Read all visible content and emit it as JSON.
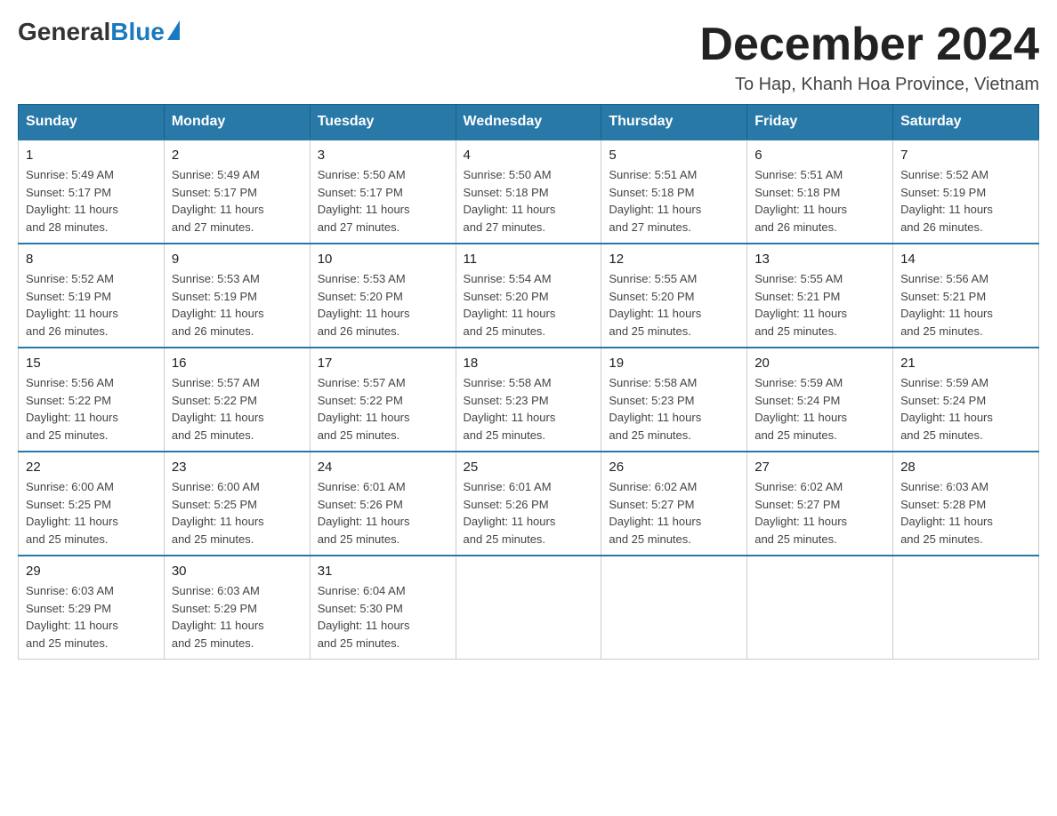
{
  "logo": {
    "general": "General",
    "blue": "Blue"
  },
  "header": {
    "month_title": "December 2024",
    "location": "To Hap, Khanh Hoa Province, Vietnam"
  },
  "days_of_week": [
    "Sunday",
    "Monday",
    "Tuesday",
    "Wednesday",
    "Thursday",
    "Friday",
    "Saturday"
  ],
  "weeks": [
    [
      {
        "day": "1",
        "sunrise": "5:49 AM",
        "sunset": "5:17 PM",
        "daylight": "11 hours and 28 minutes."
      },
      {
        "day": "2",
        "sunrise": "5:49 AM",
        "sunset": "5:17 PM",
        "daylight": "11 hours and 27 minutes."
      },
      {
        "day": "3",
        "sunrise": "5:50 AM",
        "sunset": "5:17 PM",
        "daylight": "11 hours and 27 minutes."
      },
      {
        "day": "4",
        "sunrise": "5:50 AM",
        "sunset": "5:18 PM",
        "daylight": "11 hours and 27 minutes."
      },
      {
        "day": "5",
        "sunrise": "5:51 AM",
        "sunset": "5:18 PM",
        "daylight": "11 hours and 27 minutes."
      },
      {
        "day": "6",
        "sunrise": "5:51 AM",
        "sunset": "5:18 PM",
        "daylight": "11 hours and 26 minutes."
      },
      {
        "day": "7",
        "sunrise": "5:52 AM",
        "sunset": "5:19 PM",
        "daylight": "11 hours and 26 minutes."
      }
    ],
    [
      {
        "day": "8",
        "sunrise": "5:52 AM",
        "sunset": "5:19 PM",
        "daylight": "11 hours and 26 minutes."
      },
      {
        "day": "9",
        "sunrise": "5:53 AM",
        "sunset": "5:19 PM",
        "daylight": "11 hours and 26 minutes."
      },
      {
        "day": "10",
        "sunrise": "5:53 AM",
        "sunset": "5:20 PM",
        "daylight": "11 hours and 26 minutes."
      },
      {
        "day": "11",
        "sunrise": "5:54 AM",
        "sunset": "5:20 PM",
        "daylight": "11 hours and 25 minutes."
      },
      {
        "day": "12",
        "sunrise": "5:55 AM",
        "sunset": "5:20 PM",
        "daylight": "11 hours and 25 minutes."
      },
      {
        "day": "13",
        "sunrise": "5:55 AM",
        "sunset": "5:21 PM",
        "daylight": "11 hours and 25 minutes."
      },
      {
        "day": "14",
        "sunrise": "5:56 AM",
        "sunset": "5:21 PM",
        "daylight": "11 hours and 25 minutes."
      }
    ],
    [
      {
        "day": "15",
        "sunrise": "5:56 AM",
        "sunset": "5:22 PM",
        "daylight": "11 hours and 25 minutes."
      },
      {
        "day": "16",
        "sunrise": "5:57 AM",
        "sunset": "5:22 PM",
        "daylight": "11 hours and 25 minutes."
      },
      {
        "day": "17",
        "sunrise": "5:57 AM",
        "sunset": "5:22 PM",
        "daylight": "11 hours and 25 minutes."
      },
      {
        "day": "18",
        "sunrise": "5:58 AM",
        "sunset": "5:23 PM",
        "daylight": "11 hours and 25 minutes."
      },
      {
        "day": "19",
        "sunrise": "5:58 AM",
        "sunset": "5:23 PM",
        "daylight": "11 hours and 25 minutes."
      },
      {
        "day": "20",
        "sunrise": "5:59 AM",
        "sunset": "5:24 PM",
        "daylight": "11 hours and 25 minutes."
      },
      {
        "day": "21",
        "sunrise": "5:59 AM",
        "sunset": "5:24 PM",
        "daylight": "11 hours and 25 minutes."
      }
    ],
    [
      {
        "day": "22",
        "sunrise": "6:00 AM",
        "sunset": "5:25 PM",
        "daylight": "11 hours and 25 minutes."
      },
      {
        "day": "23",
        "sunrise": "6:00 AM",
        "sunset": "5:25 PM",
        "daylight": "11 hours and 25 minutes."
      },
      {
        "day": "24",
        "sunrise": "6:01 AM",
        "sunset": "5:26 PM",
        "daylight": "11 hours and 25 minutes."
      },
      {
        "day": "25",
        "sunrise": "6:01 AM",
        "sunset": "5:26 PM",
        "daylight": "11 hours and 25 minutes."
      },
      {
        "day": "26",
        "sunrise": "6:02 AM",
        "sunset": "5:27 PM",
        "daylight": "11 hours and 25 minutes."
      },
      {
        "day": "27",
        "sunrise": "6:02 AM",
        "sunset": "5:27 PM",
        "daylight": "11 hours and 25 minutes."
      },
      {
        "day": "28",
        "sunrise": "6:03 AM",
        "sunset": "5:28 PM",
        "daylight": "11 hours and 25 minutes."
      }
    ],
    [
      {
        "day": "29",
        "sunrise": "6:03 AM",
        "sunset": "5:29 PM",
        "daylight": "11 hours and 25 minutes."
      },
      {
        "day": "30",
        "sunrise": "6:03 AM",
        "sunset": "5:29 PM",
        "daylight": "11 hours and 25 minutes."
      },
      {
        "day": "31",
        "sunrise": "6:04 AM",
        "sunset": "5:30 PM",
        "daylight": "11 hours and 25 minutes."
      },
      null,
      null,
      null,
      null
    ]
  ]
}
